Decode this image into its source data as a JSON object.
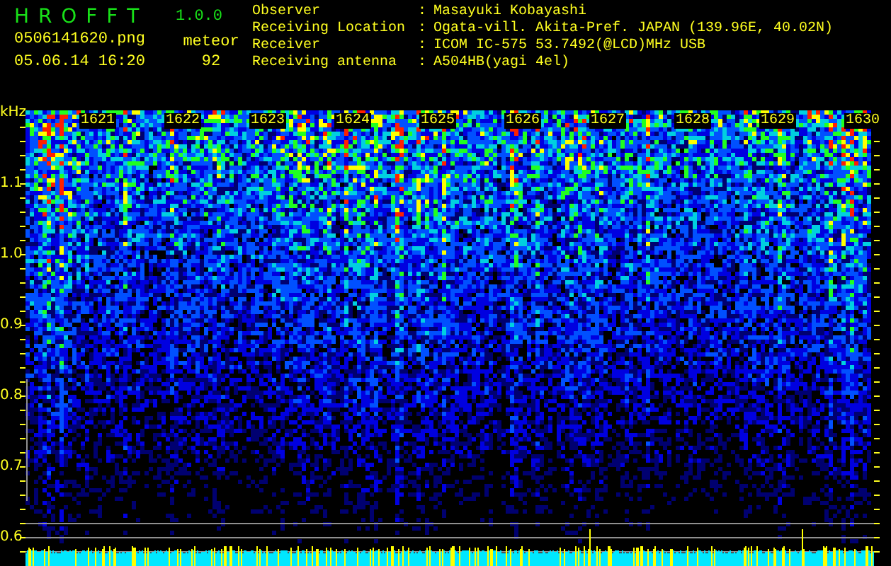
{
  "app": {
    "name": "H R O F F T",
    "version": "1.0.0"
  },
  "file": {
    "name": "0506141620.png",
    "datetime": "05.06.14 16:20"
  },
  "count": {
    "label": "meteor",
    "value": "92"
  },
  "info": [
    {
      "label": "Observer",
      "colon": ":",
      "value": "Masayuki Kobayashi"
    },
    {
      "label": "Receiving Location",
      "colon": ":",
      "value": "Ogata-vill. Akita-Pref. JAPAN (139.96E, 40.02N)"
    },
    {
      "label": "Receiver",
      "colon": ":",
      "value": "ICOM IC-575 53.7492(@LCD)MHz USB"
    },
    {
      "label": "Receiving antenna",
      "colon": ":",
      "value": "A504HB(yagi 4el)"
    }
  ],
  "spectrogram": {
    "unit": "kHz",
    "y_labels": [
      "1.1",
      "1.0",
      "0.9",
      "0.8",
      "0.7",
      "0.6"
    ],
    "time_labels": [
      "1621",
      "1622",
      "1623",
      "1624",
      "1625",
      "1626",
      "1627",
      "1628",
      "1629",
      "1630"
    ]
  }
}
